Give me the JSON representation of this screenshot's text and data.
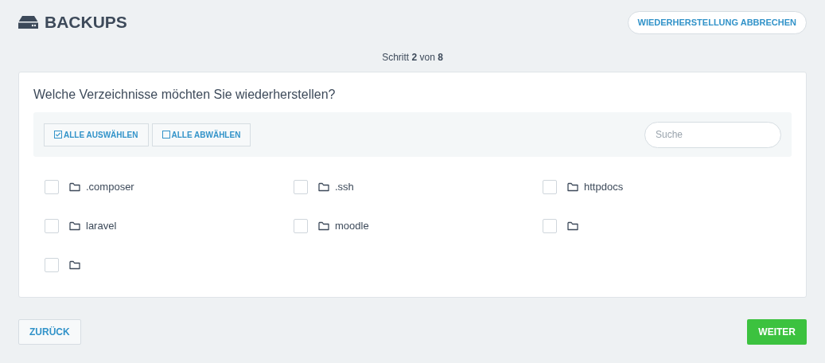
{
  "header": {
    "title": "BACKUPS",
    "cancel_button": "WIEDERHERSTELLUNG ABBRECHEN"
  },
  "step": "Schritt **2** von **8**",
  "card": {
    "question": "Welche Verzeichnisse möchten Sie wiederherstellen?",
    "toolbar": {
      "select_all": "ALLE AUSWÄHLEN",
      "deselect_all": "ALLE ABWÄHLEN",
      "search": {
        "placeholder": "Suche"
      }
    },
    "folders": [
      {
        "name": ".composer",
        "checked": false
      },
      {
        "name": ".ssh",
        "checked": false
      },
      {
        "name": "httpdocs",
        "checked": false
      },
      {
        "name": "laravel",
        "checked": false
      },
      {
        "name": "moodle",
        "checked": false
      },
      {
        "checked": false
      },
      {
        "checked": false
      }
    ]
  },
  "footer": {
    "back": "ZURÜCK",
    "next": "WEITER"
  }
}
